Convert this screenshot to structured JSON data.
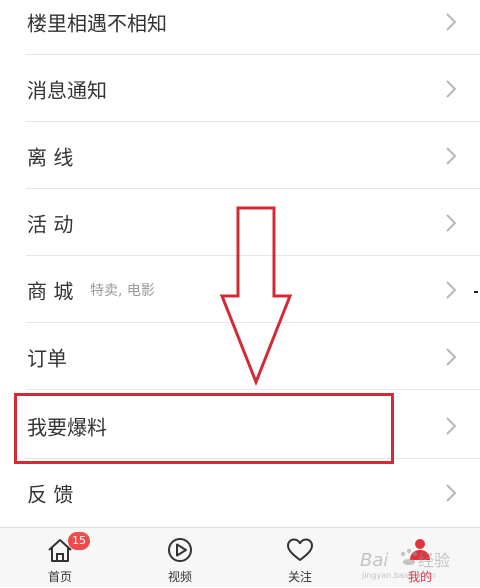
{
  "menu": {
    "items": [
      {
        "label": "楼里相遇不相知"
      },
      {
        "label": "消息通知"
      },
      {
        "label": "离 线"
      },
      {
        "label": "活 动"
      },
      {
        "label": "商 城",
        "sub": "特卖, 电影"
      },
      {
        "label": "订单"
      },
      {
        "label": "我要爆料"
      },
      {
        "label": "反 馈"
      }
    ]
  },
  "annotation": {
    "arrow_color": "#d32a36",
    "box_color": "#d32a36"
  },
  "tabbar": {
    "tabs": [
      {
        "label": "首页",
        "icon": "home-icon",
        "badge": "15"
      },
      {
        "label": "视频",
        "icon": "play-icon"
      },
      {
        "label": "关注",
        "icon": "heart-icon"
      },
      {
        "label": "我的",
        "icon": "profile-icon",
        "active": true
      }
    ],
    "active_color": "#e0323c",
    "badge_color": "#ef4b4b"
  },
  "watermark": {
    "text": "Baidu 经验"
  }
}
